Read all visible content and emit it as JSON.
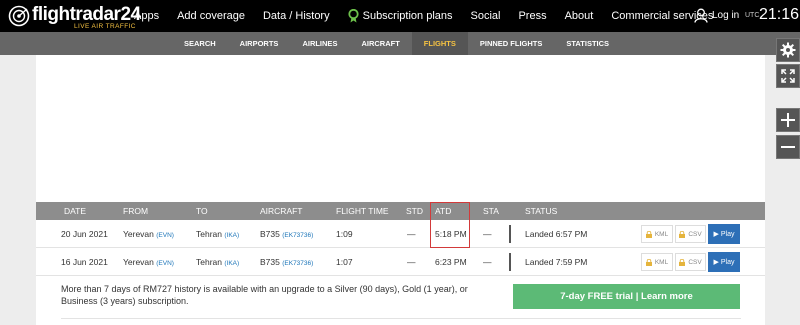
{
  "brand": {
    "name_prefix": "flightradar",
    "name_suffix": "24",
    "tagline": "LIVE AIR TRAFFIC"
  },
  "topnav": {
    "items": [
      "Apps",
      "Add coverage",
      "Data / History",
      "Subscription plans",
      "Social",
      "Press",
      "About",
      "Commercial services"
    ],
    "login": "Log in",
    "timezone": "UTC",
    "time": "21:16"
  },
  "subnav": {
    "tabs": [
      "SEARCH",
      "AIRPORTS",
      "AIRLINES",
      "AIRCRAFT",
      "FLIGHTS",
      "PINNED FLIGHTS",
      "STATISTICS"
    ],
    "active": "FLIGHTS"
  },
  "controls": [
    "gear-icon",
    "fullscreen-icon",
    "zoom-in-icon",
    "zoom-out-icon"
  ],
  "table": {
    "headers": [
      "DATE",
      "FROM",
      "TO",
      "AIRCRAFT",
      "FLIGHT TIME",
      "STD",
      "ATD",
      "STA",
      "STATUS"
    ],
    "rows": [
      {
        "date": "20 Jun 2021",
        "from": "Yerevan",
        "from_code": "(EVN)",
        "to": "Tehran",
        "to_code": "(IKA)",
        "aircraft": "B735",
        "reg": "(EK73736)",
        "flight_time": "1:09",
        "std": "—",
        "atd": "5:18 PM",
        "sta": "—",
        "status": "Landed 6:57 PM"
      },
      {
        "date": "16 Jun 2021",
        "from": "Yerevan",
        "from_code": "(EVN)",
        "to": "Tehran",
        "to_code": "(IKA)",
        "aircraft": "B735",
        "reg": "(EK73736)",
        "flight_time": "1:07",
        "std": "—",
        "atd": "6:23 PM",
        "sta": "—",
        "status": "Landed 7:59 PM"
      }
    ],
    "kml_label": "KML",
    "csv_label": "CSV",
    "play_label": "▶ Play"
  },
  "upsell": {
    "text": "More than 7 days of RM727 history is available with an upgrade to a Silver (90 days), Gold (1 year), or Business (3 years) subscription.",
    "button": "7-day FREE trial | Learn more"
  },
  "colors": {
    "accent": "#f5c242",
    "play": "#2d6fb7",
    "trial": "#5cba76",
    "highlight": "#d23a3a"
  }
}
